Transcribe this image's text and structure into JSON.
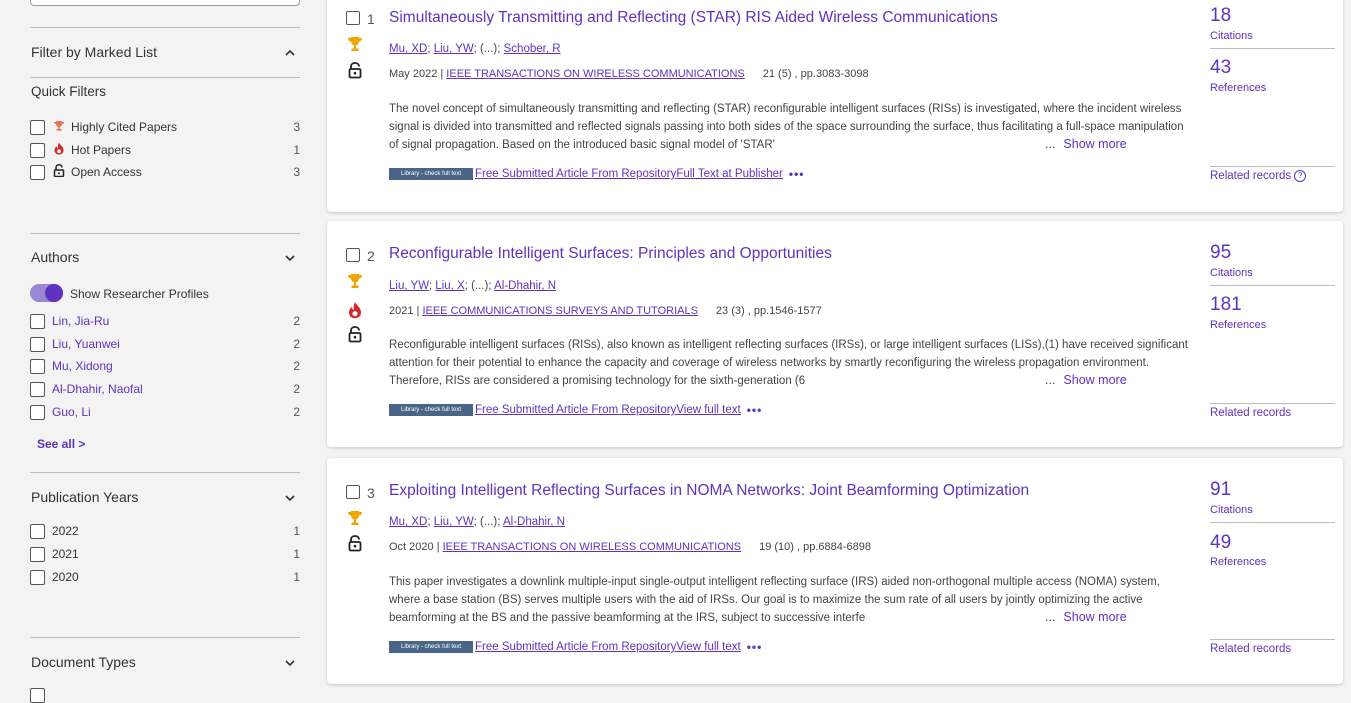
{
  "sidebar": {
    "filter_marked": "Filter by Marked List",
    "quick_filters": {
      "title": "Quick Filters",
      "items": [
        {
          "label": "Highly Cited Papers",
          "count": "3"
        },
        {
          "label": "Hot Papers",
          "count": "1"
        },
        {
          "label": "Open Access",
          "count": "3"
        }
      ]
    },
    "authors": {
      "title": "Authors",
      "toggle_label": "Show Researcher Profiles",
      "items": [
        {
          "label": "Lin, Jia-Ru",
          "count": "2"
        },
        {
          "label": "Liu, Yuanwei",
          "count": "2"
        },
        {
          "label": "Mu, Xidong",
          "count": "2"
        },
        {
          "label": "Al-Dhahir, Naofal",
          "count": "2"
        },
        {
          "label": "Guo, Li",
          "count": "2"
        }
      ],
      "see_all": "See all >"
    },
    "pub_years": {
      "title": "Publication Years",
      "items": [
        {
          "label": "2022",
          "count": "1"
        },
        {
          "label": "2021",
          "count": "1"
        },
        {
          "label": "2020",
          "count": "1"
        }
      ]
    },
    "doc_types": {
      "title": "Document Types"
    }
  },
  "common": {
    "library_badge": "Library - check full text",
    "show_more": "Show more",
    "ellipsis": "...",
    "author_sep_etal": "(...);",
    "citations_label": "Citations",
    "references_label": "References",
    "related_label": "Related records",
    "more_dots": "•••"
  },
  "records": [
    {
      "num": "1",
      "title": "Simultaneously Transmitting and Reflecting (STAR) RIS Aided Wireless Communications",
      "authors": [
        "Mu, XD",
        "Liu, YW",
        "Schober, R"
      ],
      "date": "May 2022 |",
      "journal": "IEEE TRANSACTIONS ON WIRELESS COMMUNICATIONS",
      "volume": "21 (5) , pp.3083-3098",
      "abstract": "The novel concept of simultaneously transmitting and reflecting (STAR) reconfigurable intelligent surfaces (RISs) is investigated, where the incident wireless signal is divided into transmitted and reflected signals passing into both sides of the space surrounding the surface, thus facilitating a full-space manipulation of signal propagation. Based on the introduced basic signal model of 'STAR'",
      "links": [
        "Free Submitted Article From Repository",
        "Full Text at Publisher"
      ],
      "citations": "18",
      "references": "43",
      "badges": [
        "trophy-icon",
        "unlock-icon"
      ]
    },
    {
      "num": "2",
      "title": "Reconfigurable Intelligent Surfaces: Principles and Opportunities",
      "authors": [
        "Liu, YW",
        "Liu, X",
        "Al-Dhahir, N"
      ],
      "date": "2021 |",
      "journal": "IEEE COMMUNICATIONS SURVEYS AND TUTORIALS",
      "volume": "23 (3) , pp.1546-1577",
      "abstract": "Reconfigurable intelligent surfaces (RISs), also known as intelligent reflecting surfaces (IRSs), or large intelligent surfaces (LISs),(1) have received significant attention for their potential to enhance the capacity and coverage of wireless networks by smartly reconfiguring the wireless propagation environment. Therefore, RISs are considered a promising technology for the sixth-generation (6",
      "links": [
        "Free Submitted Article From Repository",
        "View full text"
      ],
      "citations": "95",
      "references": "181",
      "badges": [
        "trophy-icon",
        "flame-icon",
        "unlock-icon"
      ]
    },
    {
      "num": "3",
      "title": "Exploiting Intelligent Reflecting Surfaces in NOMA Networks: Joint Beamforming Optimization",
      "authors": [
        "Mu, XD",
        "Liu, YW",
        "Al-Dhahir, N"
      ],
      "date": "Oct 2020 |",
      "journal": "IEEE TRANSACTIONS ON WIRELESS COMMUNICATIONS",
      "volume": "19 (10) , pp.6884-6898",
      "abstract": "This paper investigates a downlink multiple-input single-output intelligent reflecting surface (IRS) aided non-orthogonal multiple access (NOMA) system, where a base station (BS) serves multiple users with the aid of IRSs. Our goal is to maximize the sum rate of all users by jointly optimizing the active beamforming at the BS and the passive beamforming at the IRS, subject to successive interfe",
      "links": [
        "Free Submitted Article From Repository",
        "View full text"
      ],
      "citations": "91",
      "references": "49",
      "badges": [
        "trophy-icon",
        "unlock-icon"
      ]
    }
  ]
}
